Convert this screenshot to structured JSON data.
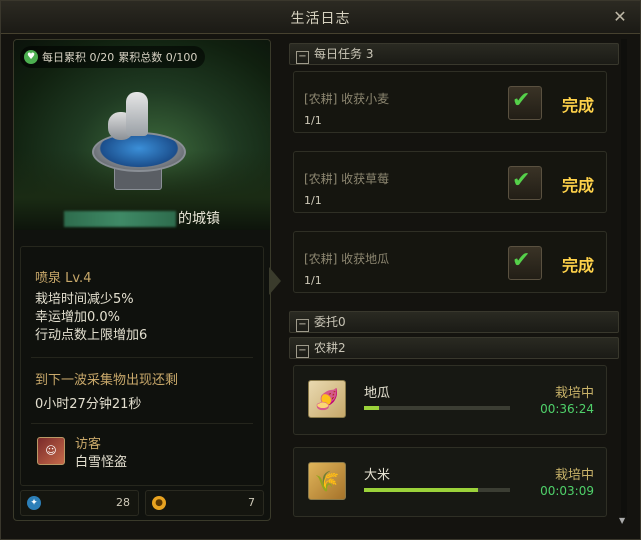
{
  "window": {
    "title": "生活日志"
  },
  "stats": {
    "daily": "每日累积 0/20",
    "total": "累积总数 0/100"
  },
  "town": {
    "suffix": "的城镇"
  },
  "facility": {
    "name": "喷泉  Lv.4",
    "bonuses": [
      "栽培时间减少5%",
      "幸运增加0.0%",
      "行动点数上限增加6"
    ],
    "next_label": "到下一波采集物出现还剩",
    "next_time": "0小时27分钟21秒",
    "visitor_label": "访客",
    "visitor_name": "白雪怪盗"
  },
  "bottom": {
    "paw_value": "28",
    "coin_value": "7"
  },
  "sections": {
    "daily": "每日任务 3",
    "commission": "委托0",
    "farming": "农耕2"
  },
  "tasks": [
    {
      "name": "[农耕] 收获小麦",
      "progress": "1/1",
      "status": "完成"
    },
    {
      "name": "[农耕] 收获草莓",
      "progress": "1/1",
      "status": "完成"
    },
    {
      "name": "[农耕] 收获地瓜",
      "progress": "1/1",
      "status": "完成"
    }
  ],
  "crops": [
    {
      "name": "地瓜",
      "status": "栽培中",
      "time": "00:36:24",
      "progress": 0.1,
      "icon": "sweet-potato-icon"
    },
    {
      "name": "大米",
      "status": "栽培中",
      "time": "00:03:09",
      "progress": 0.78,
      "icon": "rice-icon"
    }
  ],
  "colors": {
    "complete": "#ffd24a",
    "timer": "#4fd16a",
    "progress": "#9bd23a"
  }
}
